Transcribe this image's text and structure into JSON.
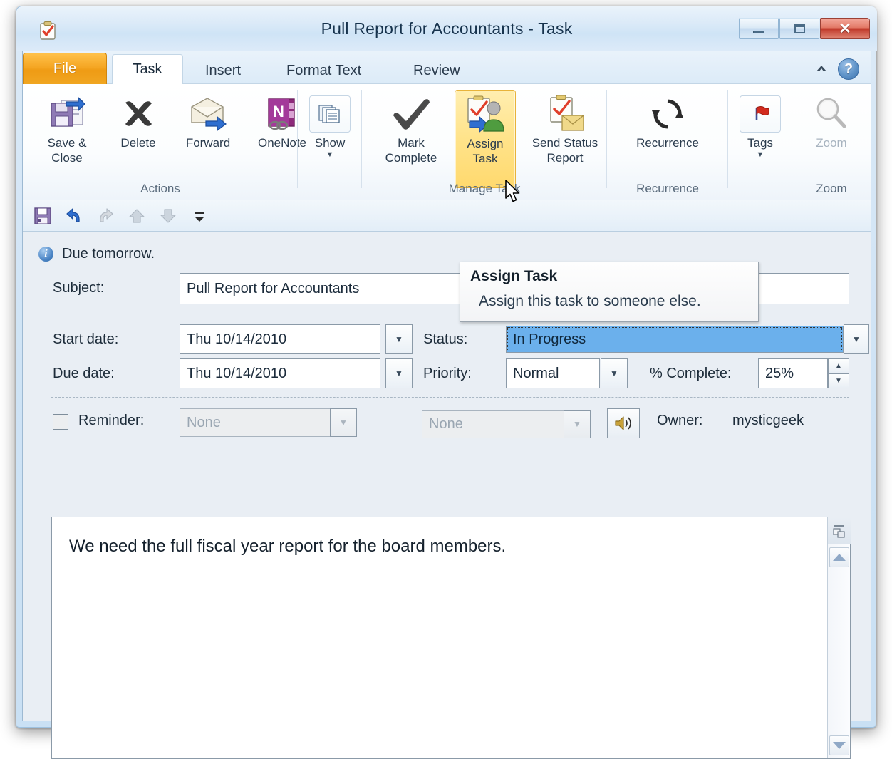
{
  "window": {
    "title": "Pull Report for Accountants  -  Task",
    "app_icon": "task-clipboard-icon",
    "controls": {
      "minimize": "Minimize",
      "maximize": "Maximize",
      "close": "Close"
    }
  },
  "tabs": [
    {
      "label": "File",
      "id": "file",
      "active": false
    },
    {
      "label": "Task",
      "id": "task",
      "active": true
    },
    {
      "label": "Insert",
      "id": "insert",
      "active": false
    },
    {
      "label": "Format Text",
      "id": "format-text",
      "active": false
    },
    {
      "label": "Review",
      "id": "review",
      "active": false
    }
  ],
  "tabbar": {
    "ribbon_minimize_icon": "chevron-up-icon",
    "help_label": "?"
  },
  "ribbon": {
    "groups": [
      {
        "name": "Actions",
        "label": "Actions",
        "buttons": [
          {
            "id": "save-close",
            "line1": "Save &",
            "line2": "Close",
            "icon": "save-and-close-icon"
          },
          {
            "id": "delete",
            "line1": "Delete",
            "line2": "",
            "icon": "delete-x-icon"
          },
          {
            "id": "forward",
            "line1": "Forward",
            "line2": "",
            "icon": "forward-envelope-icon"
          },
          {
            "id": "onenote",
            "line1": "OneNote",
            "line2": "",
            "icon": "onenote-icon"
          }
        ]
      },
      {
        "name": "show",
        "label": "",
        "buttons": [
          {
            "id": "show",
            "line1": "Show",
            "line2": "",
            "icon": "show-pages-icon",
            "has_caret": true
          }
        ]
      },
      {
        "name": "Manage Task",
        "label": "Manage Task",
        "buttons": [
          {
            "id": "mark-complete",
            "line1": "Mark",
            "line2": "Complete",
            "icon": "checkmark-icon"
          },
          {
            "id": "assign-task",
            "line1": "Assign",
            "line2": "Task",
            "icon": "assign-task-icon",
            "highlighted": true
          },
          {
            "id": "send-status-report",
            "line1": "Send Status",
            "line2": "Report",
            "icon": "send-status-report-icon"
          }
        ]
      },
      {
        "name": "Recurrence",
        "label": "Recurrence",
        "buttons": [
          {
            "id": "recurrence",
            "line1": "Recurrence",
            "line2": "",
            "icon": "recurrence-circular-arrows-icon"
          }
        ]
      },
      {
        "name": "tags",
        "label": "",
        "buttons": [
          {
            "id": "tags",
            "line1": "Tags",
            "line2": "",
            "icon": "red-flag-icon",
            "has_caret": true
          }
        ]
      },
      {
        "name": "Zoom",
        "label": "Zoom",
        "buttons": [
          {
            "id": "zoom",
            "line1": "Zoom",
            "line2": "",
            "icon": "magnifier-icon",
            "disabled": true
          }
        ]
      }
    ]
  },
  "quick_access": [
    {
      "id": "save",
      "icon": "floppy-save-icon",
      "label": "Save",
      "disabled": false
    },
    {
      "id": "undo",
      "icon": "undo-arrow-icon",
      "label": "Undo",
      "disabled": false
    },
    {
      "id": "redo",
      "icon": "redo-arrow-icon",
      "label": "Redo",
      "disabled": true
    },
    {
      "id": "previous-item",
      "icon": "previous-item-up-icon",
      "label": "Previous Item",
      "disabled": true
    },
    {
      "id": "next-item",
      "icon": "next-item-down-icon",
      "label": "Next Item",
      "disabled": true
    },
    {
      "id": "customize",
      "icon": "customize-qat-caret-icon",
      "label": "Customize Quick Access Toolbar",
      "disabled": false
    }
  ],
  "form": {
    "info_bar": {
      "icon": "info-icon",
      "text": "Due tomorrow."
    },
    "subject": {
      "label": "Subject:",
      "value": "Pull Report for Accountants",
      "placeholder": ""
    },
    "start_date": {
      "label": "Start date:",
      "value": "Thu 10/14/2010"
    },
    "due_date": {
      "label": "Due date:",
      "value": "Thu 10/14/2010"
    },
    "status": {
      "label": "Status:",
      "value": "In Progress",
      "selected": true
    },
    "priority": {
      "label": "Priority:",
      "value": "Normal"
    },
    "percent_complete": {
      "label": "% Complete:",
      "value": "25%"
    },
    "reminder": {
      "label": "Reminder:",
      "checked": false,
      "date_value": "None",
      "time_value": "None",
      "disabled": true,
      "sound_icon": "speaker-sound-icon"
    },
    "owner": {
      "label": "Owner:",
      "value": "mysticgeek"
    },
    "body": {
      "text": "We need the full fiscal year report for the board members."
    }
  },
  "tooltip": {
    "title": "Assign Task",
    "description": "Assign this task to someone else."
  },
  "colors": {
    "accent_orange": "#f0a622",
    "highlight_yellow": "#ffd96e",
    "selection_blue": "#6bb0ec",
    "close_red": "#c0392a",
    "window_chrome": "#cfe3f5"
  }
}
